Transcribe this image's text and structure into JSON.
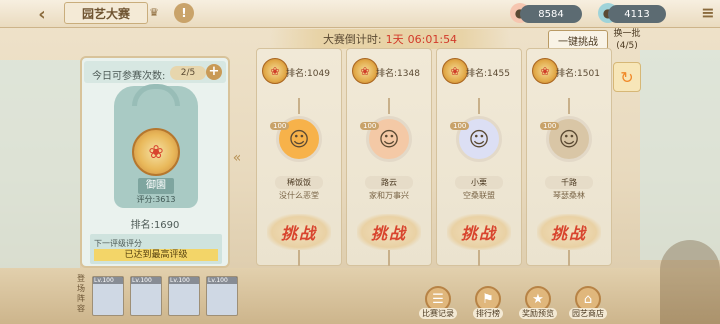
{
  "header": {
    "title": "园艺大赛",
    "back_icon": "back-arrow-icon",
    "resource1_value": "8584",
    "resource2_value": "4113"
  },
  "countdown": {
    "label": "大赛倒计时:",
    "days": "1天",
    "time": "06:01:54"
  },
  "actions": {
    "quick_challenge": "一键挑战",
    "swap_label": "换一批",
    "swap_count": "(4/5)"
  },
  "left_panel": {
    "attempts_label": "今日可参赛次数:",
    "attempts_value": "2/5",
    "rank_title": "御園",
    "score": "评分:3613",
    "ranking": "排名:1690",
    "next_tier_label": "下一评级评分",
    "next_tier_value": "已达到最高评级"
  },
  "opponents": [
    {
      "rank": "排名:1049",
      "level": "100",
      "name": "稀饭饭",
      "guild": "没什么恶堂"
    },
    {
      "rank": "排名:1348",
      "level": "100",
      "name": "路云",
      "guild": "家和万事兴"
    },
    {
      "rank": "排名:1455",
      "level": "100",
      "name": "小栗",
      "guild": "空桑联盟"
    },
    {
      "rank": "排名:1501",
      "level": "100",
      "name": "千路",
      "guild": "琴瑟桑林"
    }
  ],
  "fight_label": "挑战",
  "team": {
    "label": "登场阵容",
    "slots": [
      "Lv.100",
      "Lv.100",
      "Lv.100",
      "Lv.100"
    ]
  },
  "bottom_buttons": [
    "比赛记录",
    "排行榜",
    "奖励预览",
    "园艺商店"
  ],
  "colors": {
    "accent": "#d8452e",
    "highlight": "#f3d568",
    "panel": "#eaf2ee"
  }
}
